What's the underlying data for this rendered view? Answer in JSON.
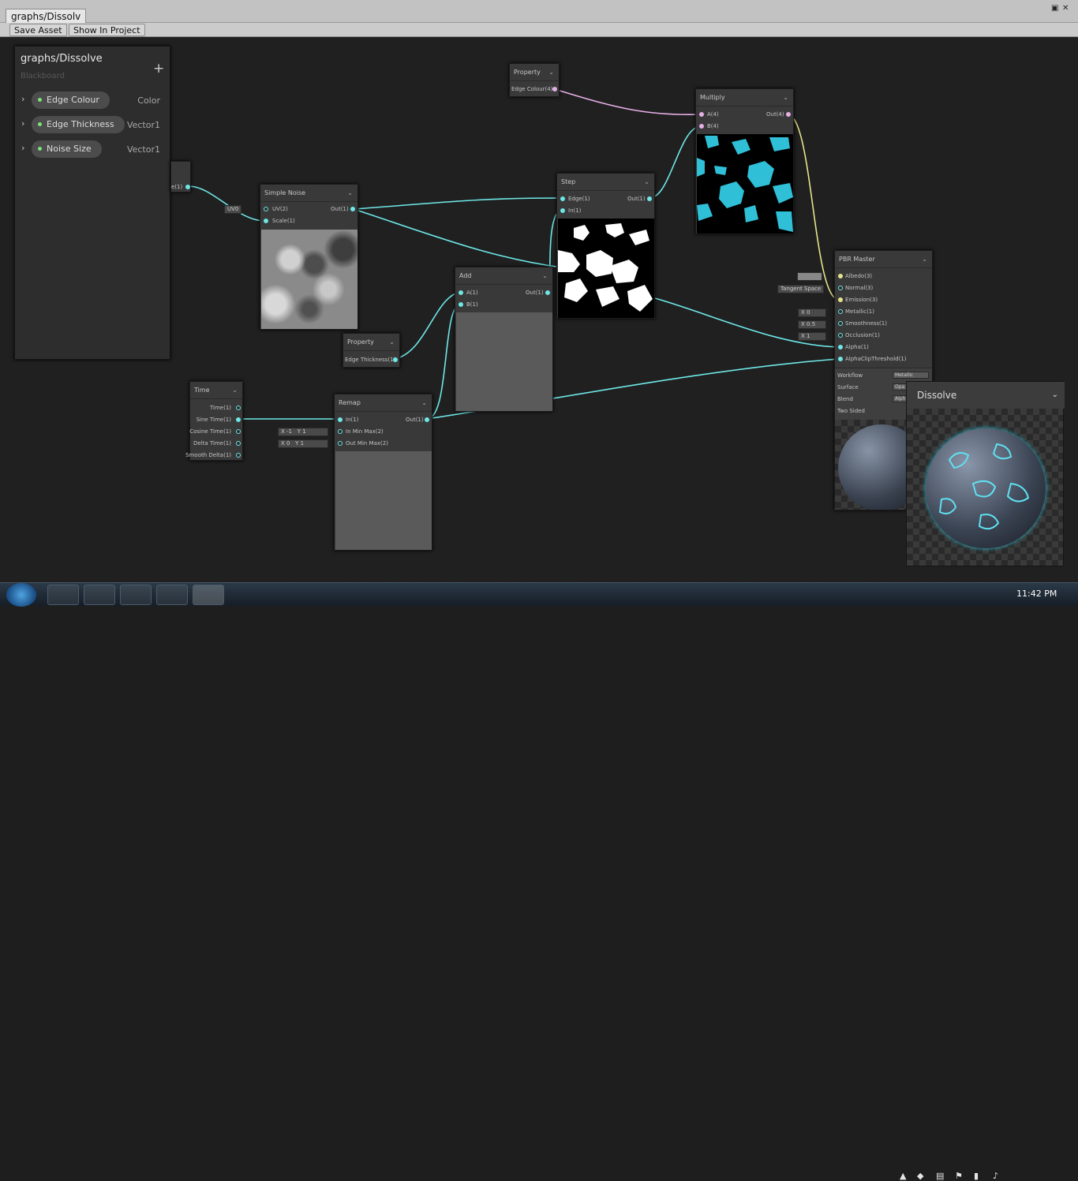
{
  "window": {
    "tab_title": "graphs/Dissolv"
  },
  "toolbar": {
    "save_label": "Save Asset",
    "show_label": "Show In Project"
  },
  "blackboard": {
    "title": "graphs/Dissolve",
    "subtitle": "Blackboard",
    "add_label": "+",
    "properties": [
      {
        "name": "Edge Colour",
        "type": "Color"
      },
      {
        "name": "Edge Thickness",
        "type": "Vector1"
      },
      {
        "name": "Noise Size",
        "type": "Vector1"
      }
    ]
  },
  "nodes": {
    "partial": {
      "out": "e(1)"
    },
    "simple_noise": {
      "title": "Simple Noise",
      "uv_default": "UV0",
      "in_uv": "UV(2)",
      "in_scale": "Scale(1)",
      "out": "Out(1)"
    },
    "prop_edge_colour": {
      "title": "Property",
      "out": "Edge Colour(4)"
    },
    "prop_edge_thickness": {
      "title": "Property",
      "out": "Edge Thickness(1)"
    },
    "time": {
      "title": "Time",
      "outs": [
        "Time(1)",
        "Sine Time(1)",
        "Cosine Time(1)",
        "Delta Time(1)",
        "Smooth Delta(1)"
      ]
    },
    "remap": {
      "title": "Remap",
      "in": "In(1)",
      "in_min_max": "In Min Max(2)",
      "out_min_max": "Out Min Max(2)",
      "out": "Out(1)",
      "in_min_x": "X -1",
      "in_min_y": "Y 1",
      "out_min_x": "X 0",
      "out_min_y": "Y 1"
    },
    "add": {
      "title": "Add",
      "in_a": "A(1)",
      "in_b": "B(1)",
      "out": "Out(1)"
    },
    "step": {
      "title": "Step",
      "in_edge": "Edge(1)",
      "in_in": "In(1)",
      "out": "Out(1)"
    },
    "multiply": {
      "title": "Multiply",
      "in_a": "A(4)",
      "in_b": "B(4)",
      "out": "Out(4)"
    },
    "pbr_master": {
      "title": "PBR Master",
      "inputs": [
        "Albedo(3)",
        "Normal(3)",
        "Emission(3)",
        "Metallic(1)",
        "Smoothness(1)",
        "Occlusion(1)",
        "Alpha(1)",
        "AlphaClipThreshold(1)"
      ],
      "normal_default": "Tangent Space",
      "metallic_default": "X 0",
      "smoothness_default": "X 0.5",
      "occlusion_default": "X 1",
      "settings": [
        {
          "label": "Workflow",
          "value": "Metallic"
        },
        {
          "label": "Surface",
          "value": "Opa"
        },
        {
          "label": "Blend",
          "value": "Alph"
        },
        {
          "label": "Two Sided",
          "value": ""
        }
      ]
    }
  },
  "main_preview": {
    "title": "Dissolve"
  },
  "taskbar": {
    "clock": "11:42 PM"
  },
  "colors": {
    "wire_float": "#6ee7e7",
    "wire_color": "#e6b0e6",
    "wire_vec3": "#e4e48a",
    "accent_cyan": "#2fc0d8"
  }
}
